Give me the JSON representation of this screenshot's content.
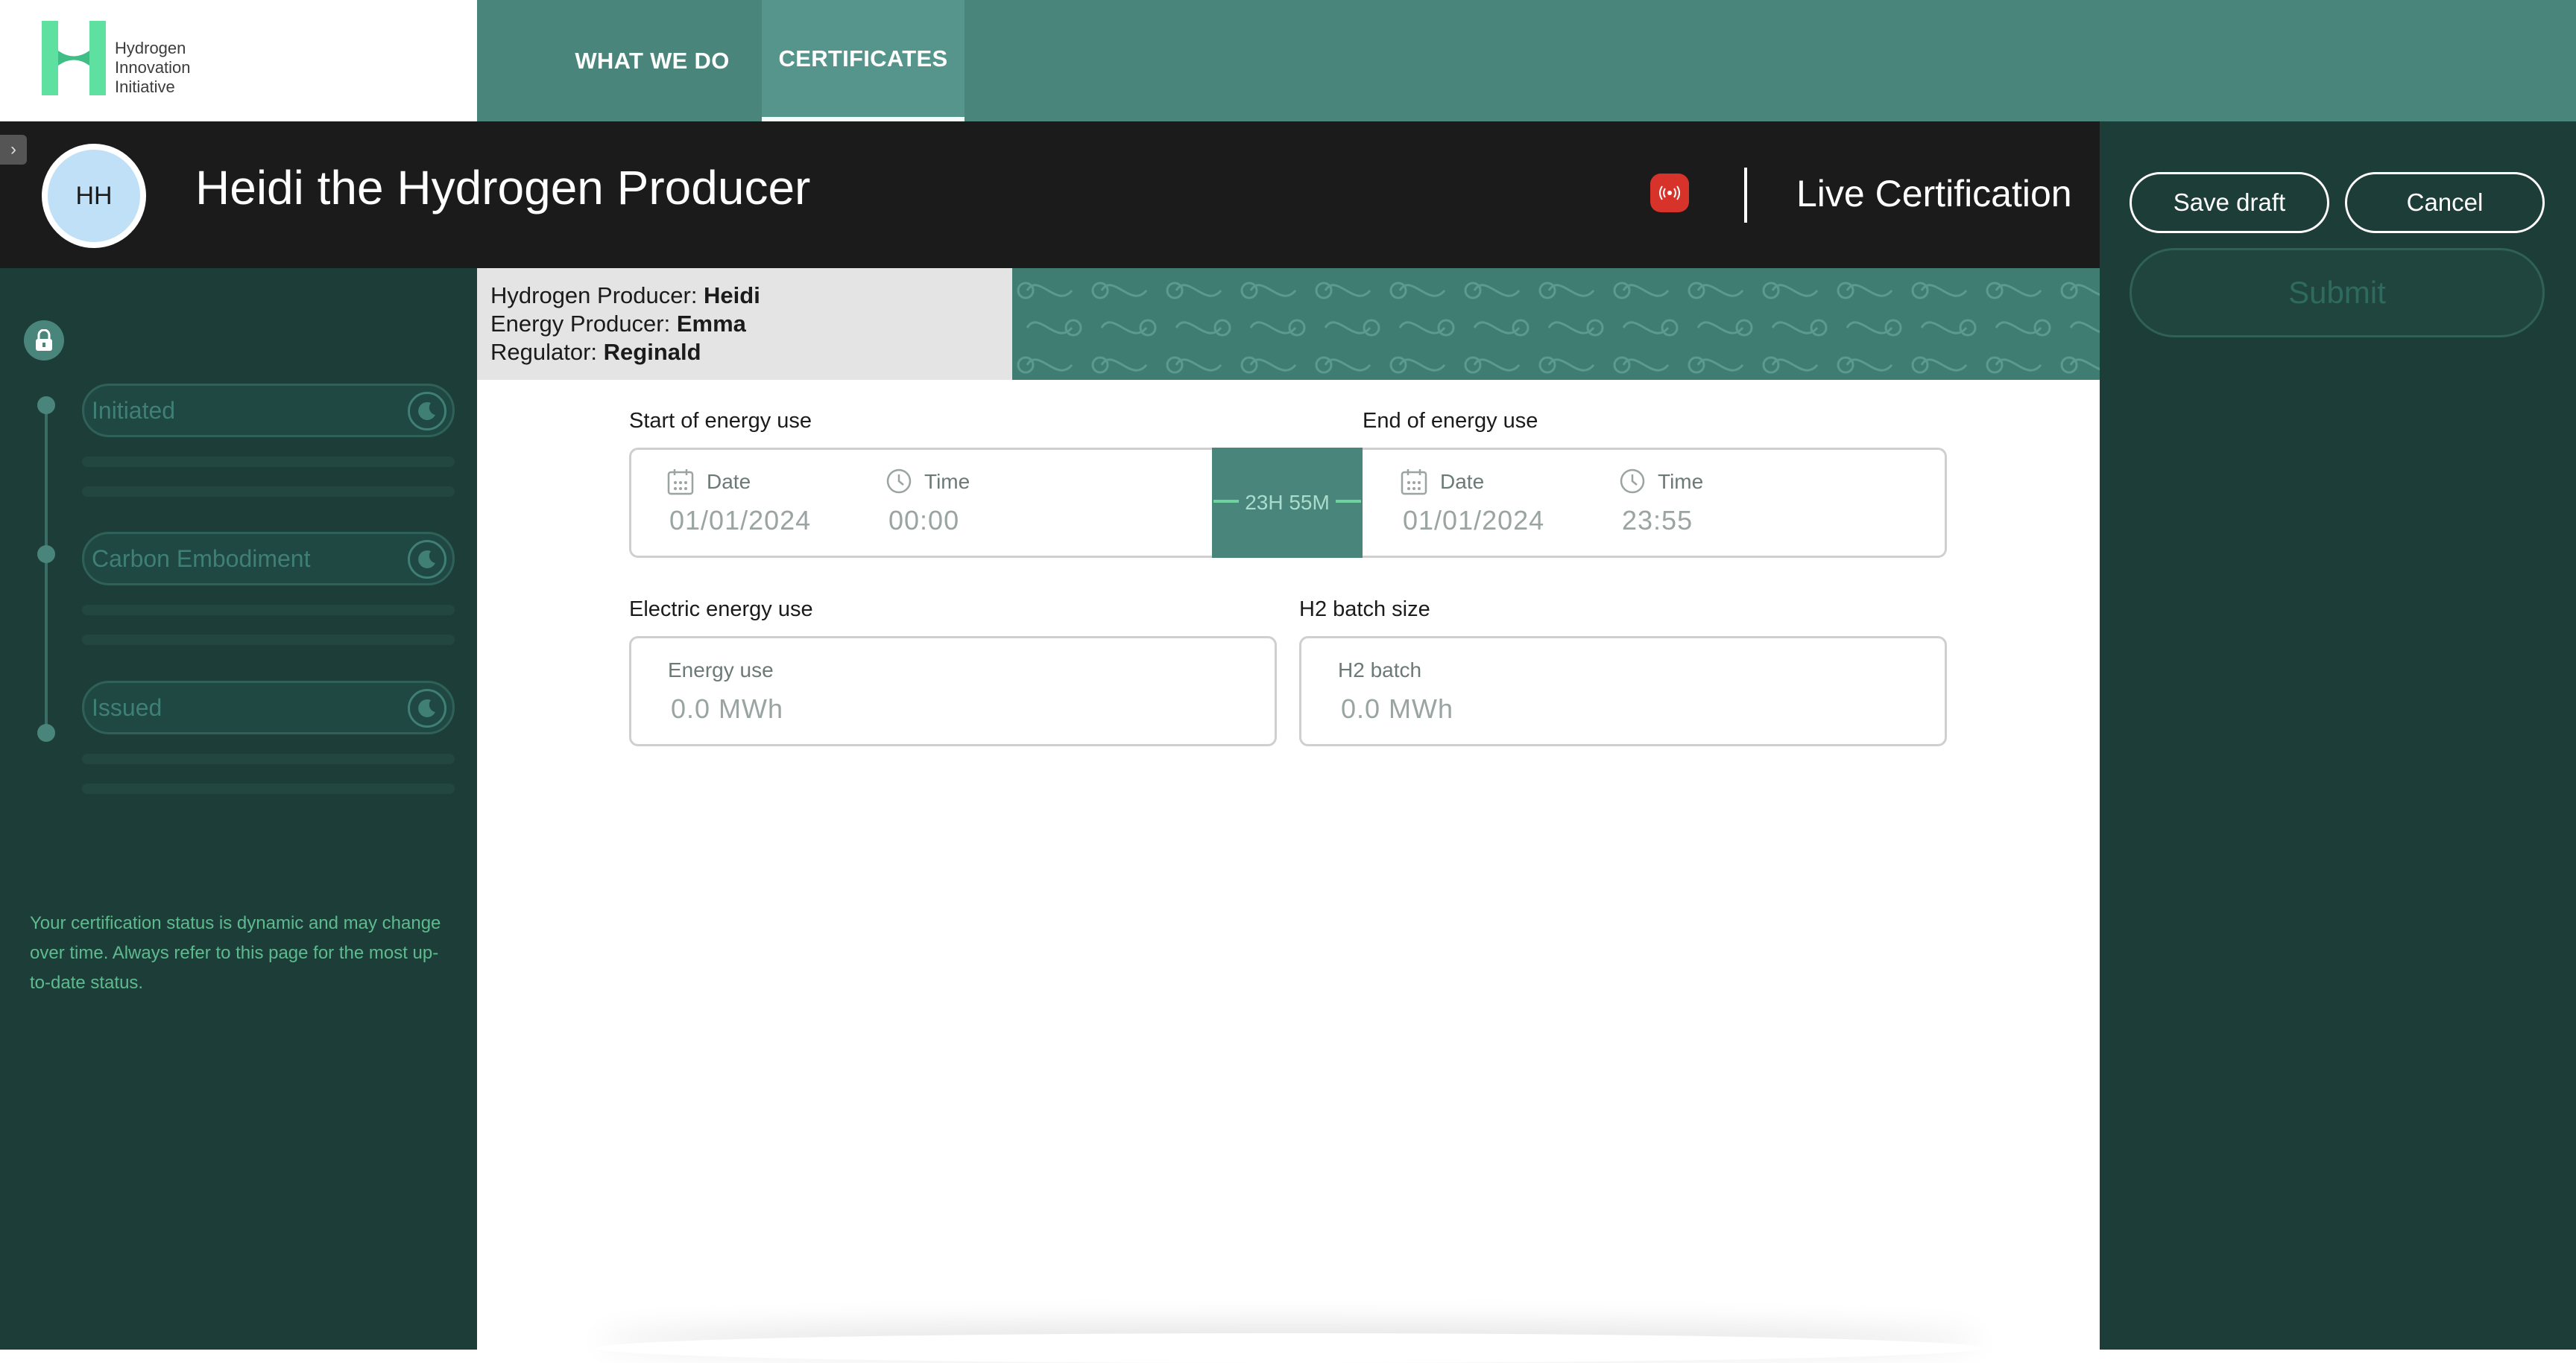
{
  "logo": {
    "line1": "Hydrogen",
    "line2": "Innovation",
    "line3": "Initiative"
  },
  "nav": {
    "what_we_do": "WHAT WE DO",
    "certificates": "CERTIFICATES"
  },
  "header": {
    "avatar_initials": "HH",
    "title": "Heidi the Hydrogen Producer",
    "live_label": "Live Certification"
  },
  "actions": {
    "save_draft": "Save draft",
    "cancel": "Cancel",
    "submit": "Submit"
  },
  "participants": {
    "hydrogen_producer_label": "Hydrogen Producer: ",
    "hydrogen_producer": "Heidi",
    "energy_producer_label": "Energy Producer: ",
    "energy_producer": "Emma",
    "regulator_label": "Regulator: ",
    "regulator": "Reginald"
  },
  "steps": [
    {
      "label": "Initiated"
    },
    {
      "label": "Carbon Embodiment"
    },
    {
      "label": "Issued"
    }
  ],
  "status_note": "Your certification status is dynamic and may change over time. Always refer to this page for the most up-to-date status.",
  "form": {
    "start": {
      "section": "Start of energy use",
      "date_label": "Date",
      "date_value": "01/01/2024",
      "time_label": "Time",
      "time_value": "00:00"
    },
    "duration": "23H 55M",
    "end": {
      "section": "End of energy use",
      "date_label": "Date",
      "date_value": "01/01/2024",
      "time_label": "Time",
      "time_value": "23:55"
    },
    "energy": {
      "section": "Electric energy use",
      "label": "Energy use",
      "placeholder": "0.0 MWh"
    },
    "h2": {
      "section": "H2 batch size",
      "label": "H2 batch",
      "placeholder": "0.0 MWh"
    }
  },
  "colors": {
    "brand_teal": "#4a857c",
    "dark_green": "#1d3e38",
    "header_black": "#1b1b1b",
    "live_red": "#d8332a",
    "accent_green": "#5dbb8f"
  }
}
